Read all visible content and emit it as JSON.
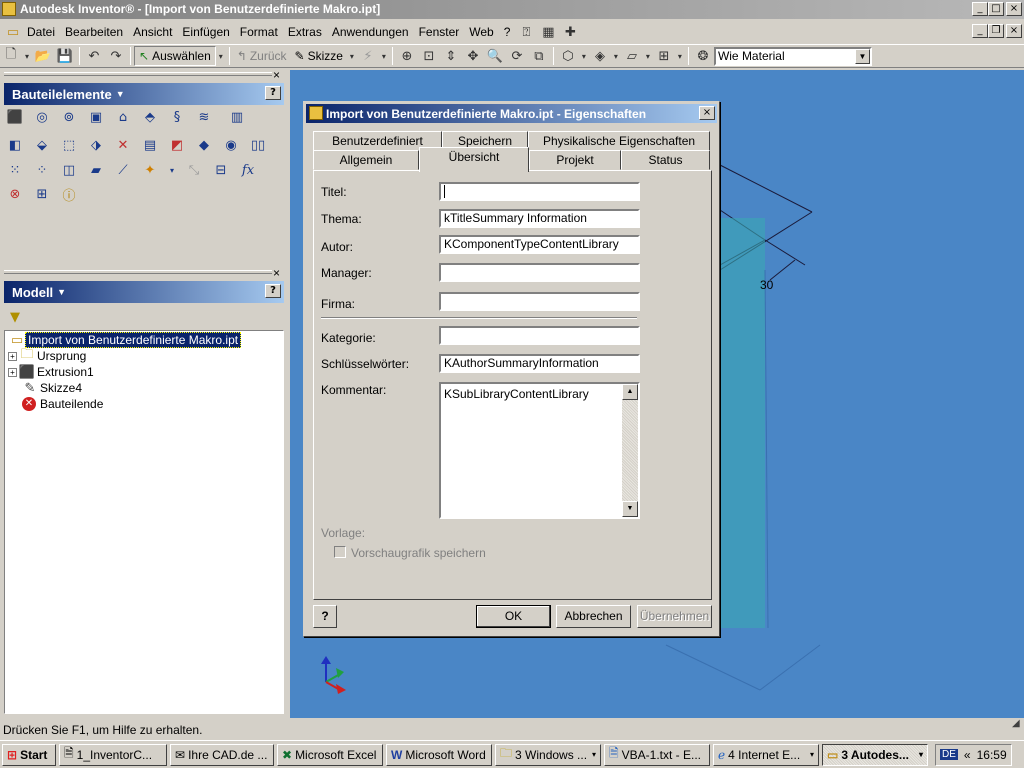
{
  "app": {
    "title": "Autodesk Inventor® - [Import von Benutzerdefinierte Makro.ipt]"
  },
  "menu": [
    "Datei",
    "Bearbeiten",
    "Ansicht",
    "Einfügen",
    "Format",
    "Extras",
    "Anwendungen",
    "Fenster",
    "Web",
    "?"
  ],
  "toolbar": {
    "select_label": "Auswählen",
    "back_label": "Zurück",
    "sketch_label": "Skizze",
    "material_value": "Wie Material"
  },
  "features_panel": {
    "title": "Bauteilelemente"
  },
  "model_panel": {
    "title": "Modell"
  },
  "tree": {
    "root": "Import von Benutzerdefinierte Makro.ipt",
    "items": [
      "Ursprung",
      "Extrusion1",
      "Skizze4",
      "Bauteilende"
    ]
  },
  "viewport": {
    "dimension": "30"
  },
  "dialog": {
    "title": "Import von Benutzerdefinierte Makro.ipt - Eigenschaften",
    "tabs_back": [
      "Benutzerdefiniert",
      "Speichern",
      "Physikalische Eigenschaften"
    ],
    "tabs_front": [
      "Allgemein",
      "Übersicht",
      "Projekt",
      "Status"
    ],
    "fields": {
      "titel_label": "Titel:",
      "titel_value": "",
      "thema_label": "Thema:",
      "thema_value": "kTitleSummary Information",
      "autor_label": "Autor:",
      "autor_value": "KComponentTypeContentLibrary",
      "manager_label": "Manager:",
      "manager_value": "",
      "firma_label": "Firma:",
      "firma_value": "",
      "kategorie_label": "Kategorie:",
      "kategorie_value": "",
      "keywords_label": "Schlüsselwörter:",
      "keywords_value": "KAuthorSummaryInformation",
      "comment_label": "Kommentar:",
      "comment_value": "KSubLibraryContentLibrary"
    },
    "vorlage_label": "Vorlage:",
    "preview_label": "Vorschaugrafik speichern",
    "ok_label": "OK",
    "cancel_label": "Abbrechen",
    "apply_label": "Übernehmen"
  },
  "status": {
    "text": "Drücken Sie F1, um Hilfe zu erhalten."
  },
  "taskbar": {
    "start_label": "Start",
    "tasks": [
      "1_InventorC...",
      "Ihre CAD.de ...",
      "Microsoft Excel",
      "Microsoft Word",
      "3 Windows ...",
      "VBA-1.txt - E...",
      "4 Internet E...",
      "3 Autodes..."
    ],
    "lang": "DE",
    "clock": "16:59"
  }
}
